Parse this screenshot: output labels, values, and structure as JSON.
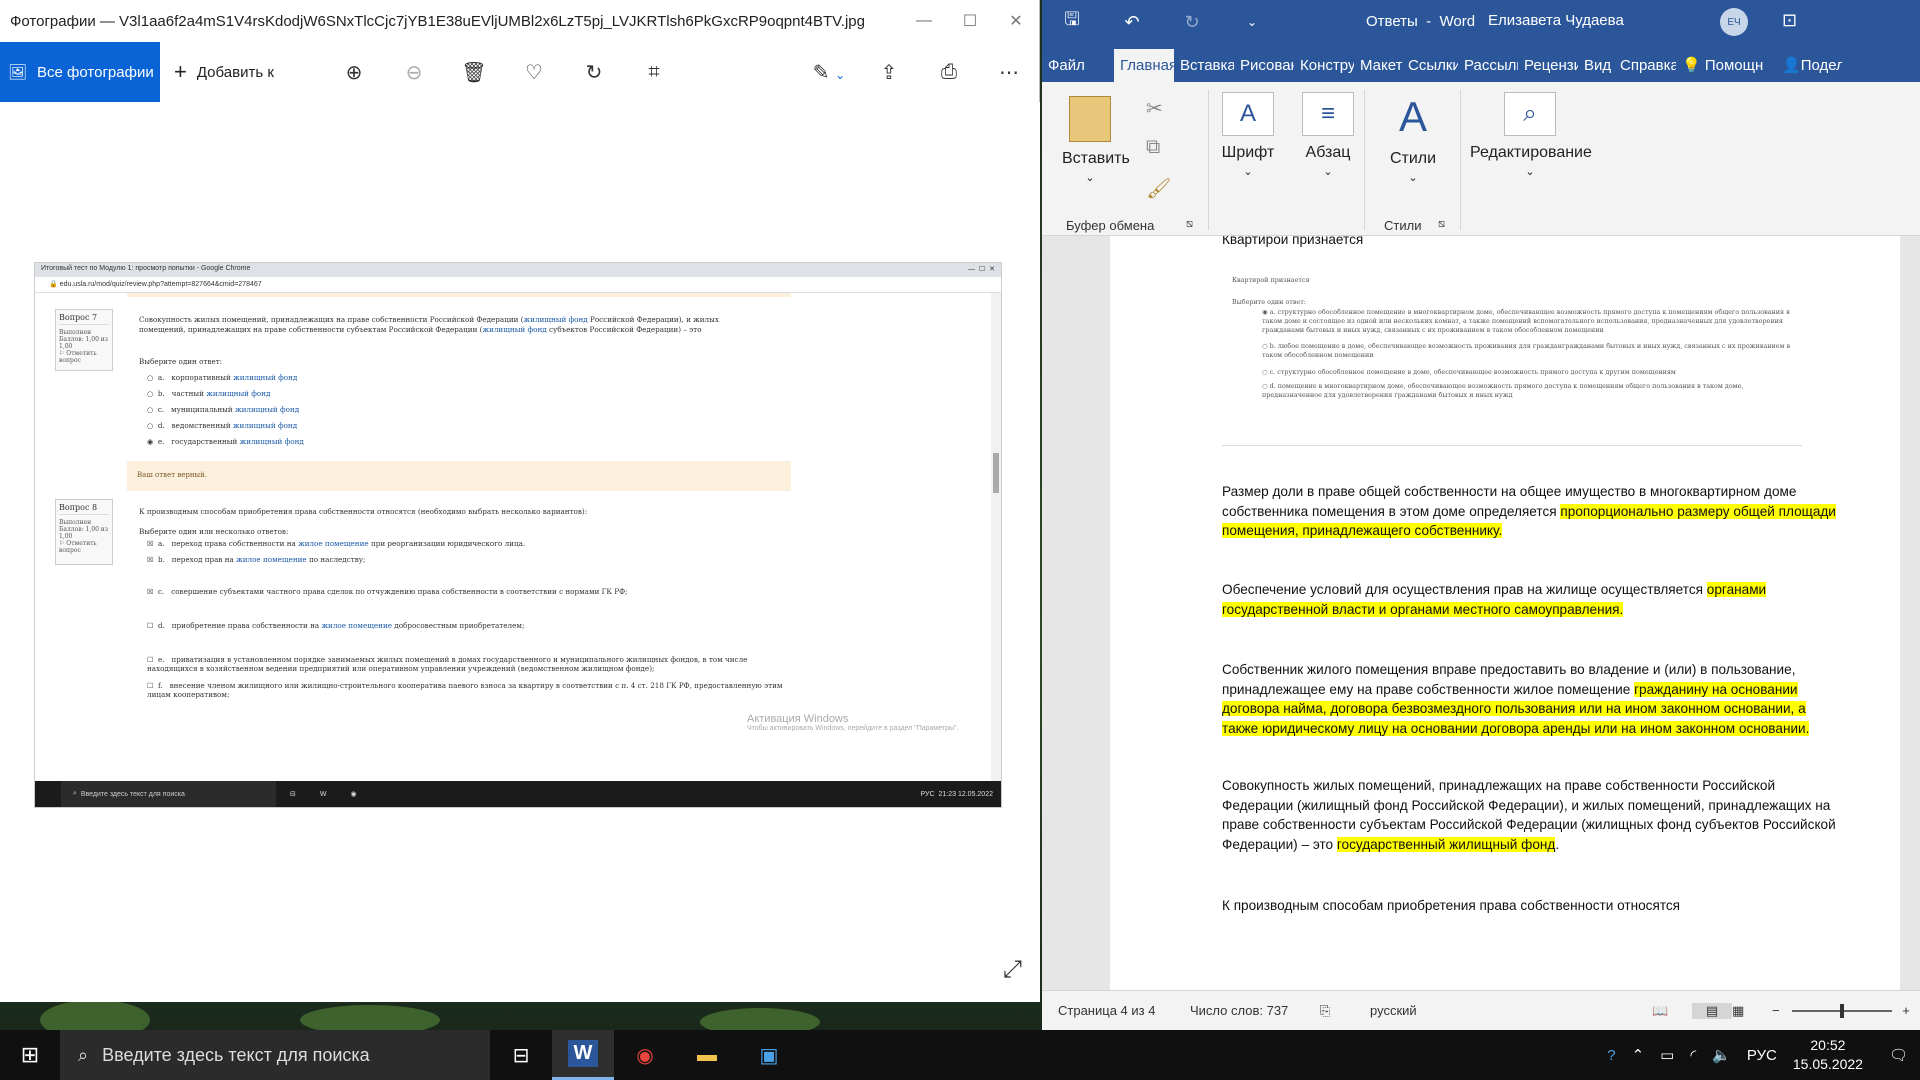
{
  "photos": {
    "title": "Фотографии — V3l1aa6f2a4mS1V4rsKdodjW6SNxTlcCjc7jYB1E38uEVljUMBl2x6LzT5pj_LVJKRTlsh6PkGxcRP9oqpnt4BTV.jpg",
    "all_photos_label": "Все фотографии",
    "add_to_label": "Добавить к",
    "screenshot": {
      "chrome_title": "Итоговый тест по Модулю 1: просмотр попытки - Google Chrome",
      "url": "edu.usla.ru/mod/quiz/review.php?attempt=827664&cmid=278467",
      "q7": {
        "label": "Вопрос 7",
        "status": "Выполнен",
        "score": "Баллов: 1,00 из 1,00",
        "flag": "Отметить вопрос",
        "text_a": "Совокупность жилых помещений, принадлежащих на праве собственности Российской Федерации (",
        "link1": "жилищный фонд",
        "text_b": " Российской Федерации), и жилых помещений, принадлежащих на праве собственности субъектам Российской Федерации (",
        "link2": "жилищный фонд",
        "text_c": " субъектов Российской Федерации) – это",
        "prompt": "Выберите один ответ:",
        "options": [
          {
            "letter": "a.",
            "text": "корпоративный ",
            "link": "жилищный фонд"
          },
          {
            "letter": "b.",
            "text": "частный ",
            "link": "жилищный фонд"
          },
          {
            "letter": "c.",
            "text": "муниципальный ",
            "link": "жилищный фонд"
          },
          {
            "letter": "d.",
            "text": "ведомственный ",
            "link": "жилищный фонд"
          },
          {
            "letter": "e.",
            "text": "государственный ",
            "link": "жилищный фонд"
          }
        ],
        "feedback": "Ваш ответ верный."
      },
      "q8": {
        "label": "Вопрос 8",
        "status": "Выполнен",
        "score": "Баллов: 1,00 из 1,00",
        "flag": "Отметить вопрос",
        "text": "К производным способам приобретения права собственности относятся (необходимо выбрать несколько вариантов):",
        "prompt": "Выберите один или несколько ответов:",
        "options": [
          {
            "letter": "a.",
            "pre": "переход права собственности на ",
            "link": "жилое помещение",
            "post": " при реорганизации юридического лица."
          },
          {
            "letter": "b.",
            "pre": "переход прав на ",
            "link": "жилое помещение",
            "post": " по наследству;"
          },
          {
            "letter": "c.",
            "pre": "совершение субъектами частного права сделок по отчуждению права собственности в соответствии с нормами ГК РФ;",
            "link": "",
            "post": ""
          },
          {
            "letter": "d.",
            "pre": "приобретение права собственности на ",
            "link": "жилое помещение",
            "post": " добросовестным приобретателем;"
          },
          {
            "letter": "e.",
            "pre": "приватизация в установленном порядке занимаемых жилых помещений в домах государственного и муниципального жилищных фондов, в том числе находящихся в хозяйственном ведении предприятий или оперативном управлении учреждений (ведомственном жилищном фонде);",
            "link": "",
            "post": ""
          },
          {
            "letter": "f.",
            "pre": "внесение членом жилищного или жилищно-строительного кооператива паевого взноса за квартиру в соответствии с п. 4 ст. 218 ГК РФ, предоставленную этим лицам кооперативом;",
            "link": "",
            "post": ""
          }
        ]
      },
      "watermark_title": "Активация Windows",
      "watermark_sub": "Чтобы активировать Windows, перейдите в раздел \"Параметры\".",
      "taskbar_search": "Введите здесь текст для поиска",
      "tray_lang": "РУС",
      "tray_time": "21:23",
      "tray_date": "12.05.2022"
    }
  },
  "word": {
    "doc_name": "Ответы",
    "app_name": "Word",
    "user_name": "Елизавета Чудаева",
    "user_initials": "ЕЧ",
    "tabs": [
      "Файл",
      "Главная",
      "Вставка",
      "Рисован",
      "Констру",
      "Макет",
      "Ссылки",
      "Рассылк",
      "Рецензи",
      "Вид",
      "Справка",
      "Помощн",
      "Подел"
    ],
    "ribbon": {
      "paste": "Вставить",
      "clipboard_group": "Буфер обмена",
      "font": "Шрифт",
      "paragraph": "Абзац",
      "styles": "Стили",
      "styles_group": "Стили",
      "editing": "Редактирование"
    },
    "page": {
      "heading_cut": "Квартирой признается",
      "img": {
        "title": "Квартирой признается",
        "prompt": "Выберите один ответ:",
        "a": "структурно обособленное помещение в многоквартирном доме, обеспечивающее возможность прямого доступа к помещениям общего пользования в таком доме и состоящее из одной или нескольких комнат, а также помещений вспомогательного использования, предназначенных для удовлетворения гражданами бытовых и иных нужд, связанных с их проживанием в таком обособленном помещении",
        "b": "любое помещение в доме, обеспечивающее возможность проживания для граждангражданами бытовых и иных нужд, связанных с их проживанием в таком обособленном помещении",
        "c": "структурно обособленное помещение в доме, обеспечивающее возможность прямого доступа к другим помещениям",
        "d": "помещение в многоквартирном доме, обеспечивающее возможность прямого доступа к помещениям общего пользования в таком доме, предназначенное для удовлетворения гражданами бытовых и иных нужд"
      },
      "p1_plain": "Размер доли в праве общей собственности на общее имущество в многоквартирном доме собственника помещения в этом доме определяется ",
      "p1_hl": "пропорционально размеру общей площади помещения, принадлежащего собственнику.",
      "p2_plain": "Обеспечение условий для осуществления прав на жилище осуществляется ",
      "p2_hl": "органами государственной власти и органами местного самоуправления.",
      "p3_plain": "Собственник жилого помещения вправе предоставить во владение и (или) в пользование, принадлежащее ему на праве собственности жилое помещение ",
      "p3_hl": "гражданину на основании договора найма, договора безвозмездного пользования или на ином законном основании, а также юридическому лицу на основании договора аренды или на ином законном основании.",
      "p4_plain": "Совокупность жилых помещений, принадлежащих на праве собственности Российской Федерации (жилищный фонд Российской Федерации), и жилых помещений, принадлежащих на праве собственности субъектам Российской Федерации (жилищных фонд субъектов Российской Федерации) – это ",
      "p4_hl": "государственный жилищный фонд",
      "p4_end": ".",
      "p5": " К производным способам приобретения права собственности относятся"
    },
    "status": {
      "page": "Страница 4 из 4",
      "words": "Число слов: 737",
      "language": "русский"
    }
  },
  "taskbar": {
    "search_placeholder": "Введите здесь текст для поиска",
    "lang": "РУС",
    "time": "20:52",
    "date": "15.05.2022"
  }
}
